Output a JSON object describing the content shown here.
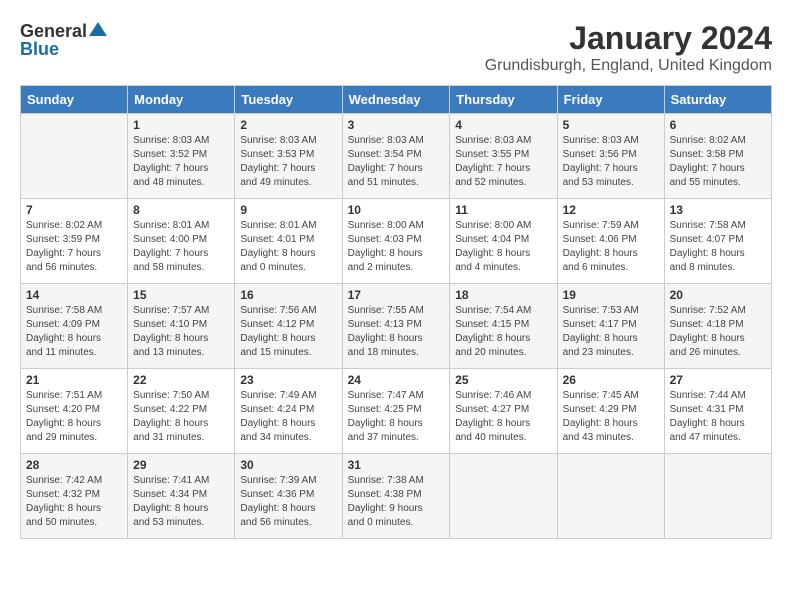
{
  "logo": {
    "general": "General",
    "blue": "Blue"
  },
  "header": {
    "month": "January 2024",
    "location": "Grundisburgh, England, United Kingdom"
  },
  "weekdays": [
    "Sunday",
    "Monday",
    "Tuesday",
    "Wednesday",
    "Thursday",
    "Friday",
    "Saturday"
  ],
  "weeks": [
    [
      {
        "day": "",
        "info": ""
      },
      {
        "day": "1",
        "info": "Sunrise: 8:03 AM\nSunset: 3:52 PM\nDaylight: 7 hours\nand 48 minutes."
      },
      {
        "day": "2",
        "info": "Sunrise: 8:03 AM\nSunset: 3:53 PM\nDaylight: 7 hours\nand 49 minutes."
      },
      {
        "day": "3",
        "info": "Sunrise: 8:03 AM\nSunset: 3:54 PM\nDaylight: 7 hours\nand 51 minutes."
      },
      {
        "day": "4",
        "info": "Sunrise: 8:03 AM\nSunset: 3:55 PM\nDaylight: 7 hours\nand 52 minutes."
      },
      {
        "day": "5",
        "info": "Sunrise: 8:03 AM\nSunset: 3:56 PM\nDaylight: 7 hours\nand 53 minutes."
      },
      {
        "day": "6",
        "info": "Sunrise: 8:02 AM\nSunset: 3:58 PM\nDaylight: 7 hours\nand 55 minutes."
      }
    ],
    [
      {
        "day": "7",
        "info": "Sunrise: 8:02 AM\nSunset: 3:59 PM\nDaylight: 7 hours\nand 56 minutes."
      },
      {
        "day": "8",
        "info": "Sunrise: 8:01 AM\nSunset: 4:00 PM\nDaylight: 7 hours\nand 58 minutes."
      },
      {
        "day": "9",
        "info": "Sunrise: 8:01 AM\nSunset: 4:01 PM\nDaylight: 8 hours\nand 0 minutes."
      },
      {
        "day": "10",
        "info": "Sunrise: 8:00 AM\nSunset: 4:03 PM\nDaylight: 8 hours\nand 2 minutes."
      },
      {
        "day": "11",
        "info": "Sunrise: 8:00 AM\nSunset: 4:04 PM\nDaylight: 8 hours\nand 4 minutes."
      },
      {
        "day": "12",
        "info": "Sunrise: 7:59 AM\nSunset: 4:06 PM\nDaylight: 8 hours\nand 6 minutes."
      },
      {
        "day": "13",
        "info": "Sunrise: 7:58 AM\nSunset: 4:07 PM\nDaylight: 8 hours\nand 8 minutes."
      }
    ],
    [
      {
        "day": "14",
        "info": "Sunrise: 7:58 AM\nSunset: 4:09 PM\nDaylight: 8 hours\nand 11 minutes."
      },
      {
        "day": "15",
        "info": "Sunrise: 7:57 AM\nSunset: 4:10 PM\nDaylight: 8 hours\nand 13 minutes."
      },
      {
        "day": "16",
        "info": "Sunrise: 7:56 AM\nSunset: 4:12 PM\nDaylight: 8 hours\nand 15 minutes."
      },
      {
        "day": "17",
        "info": "Sunrise: 7:55 AM\nSunset: 4:13 PM\nDaylight: 8 hours\nand 18 minutes."
      },
      {
        "day": "18",
        "info": "Sunrise: 7:54 AM\nSunset: 4:15 PM\nDaylight: 8 hours\nand 20 minutes."
      },
      {
        "day": "19",
        "info": "Sunrise: 7:53 AM\nSunset: 4:17 PM\nDaylight: 8 hours\nand 23 minutes."
      },
      {
        "day": "20",
        "info": "Sunrise: 7:52 AM\nSunset: 4:18 PM\nDaylight: 8 hours\nand 26 minutes."
      }
    ],
    [
      {
        "day": "21",
        "info": "Sunrise: 7:51 AM\nSunset: 4:20 PM\nDaylight: 8 hours\nand 29 minutes."
      },
      {
        "day": "22",
        "info": "Sunrise: 7:50 AM\nSunset: 4:22 PM\nDaylight: 8 hours\nand 31 minutes."
      },
      {
        "day": "23",
        "info": "Sunrise: 7:49 AM\nSunset: 4:24 PM\nDaylight: 8 hours\nand 34 minutes."
      },
      {
        "day": "24",
        "info": "Sunrise: 7:47 AM\nSunset: 4:25 PM\nDaylight: 8 hours\nand 37 minutes."
      },
      {
        "day": "25",
        "info": "Sunrise: 7:46 AM\nSunset: 4:27 PM\nDaylight: 8 hours\nand 40 minutes."
      },
      {
        "day": "26",
        "info": "Sunrise: 7:45 AM\nSunset: 4:29 PM\nDaylight: 8 hours\nand 43 minutes."
      },
      {
        "day": "27",
        "info": "Sunrise: 7:44 AM\nSunset: 4:31 PM\nDaylight: 8 hours\nand 47 minutes."
      }
    ],
    [
      {
        "day": "28",
        "info": "Sunrise: 7:42 AM\nSunset: 4:32 PM\nDaylight: 8 hours\nand 50 minutes."
      },
      {
        "day": "29",
        "info": "Sunrise: 7:41 AM\nSunset: 4:34 PM\nDaylight: 8 hours\nand 53 minutes."
      },
      {
        "day": "30",
        "info": "Sunrise: 7:39 AM\nSunset: 4:36 PM\nDaylight: 8 hours\nand 56 minutes."
      },
      {
        "day": "31",
        "info": "Sunrise: 7:38 AM\nSunset: 4:38 PM\nDaylight: 9 hours\nand 0 minutes."
      },
      {
        "day": "",
        "info": ""
      },
      {
        "day": "",
        "info": ""
      },
      {
        "day": "",
        "info": ""
      }
    ]
  ]
}
